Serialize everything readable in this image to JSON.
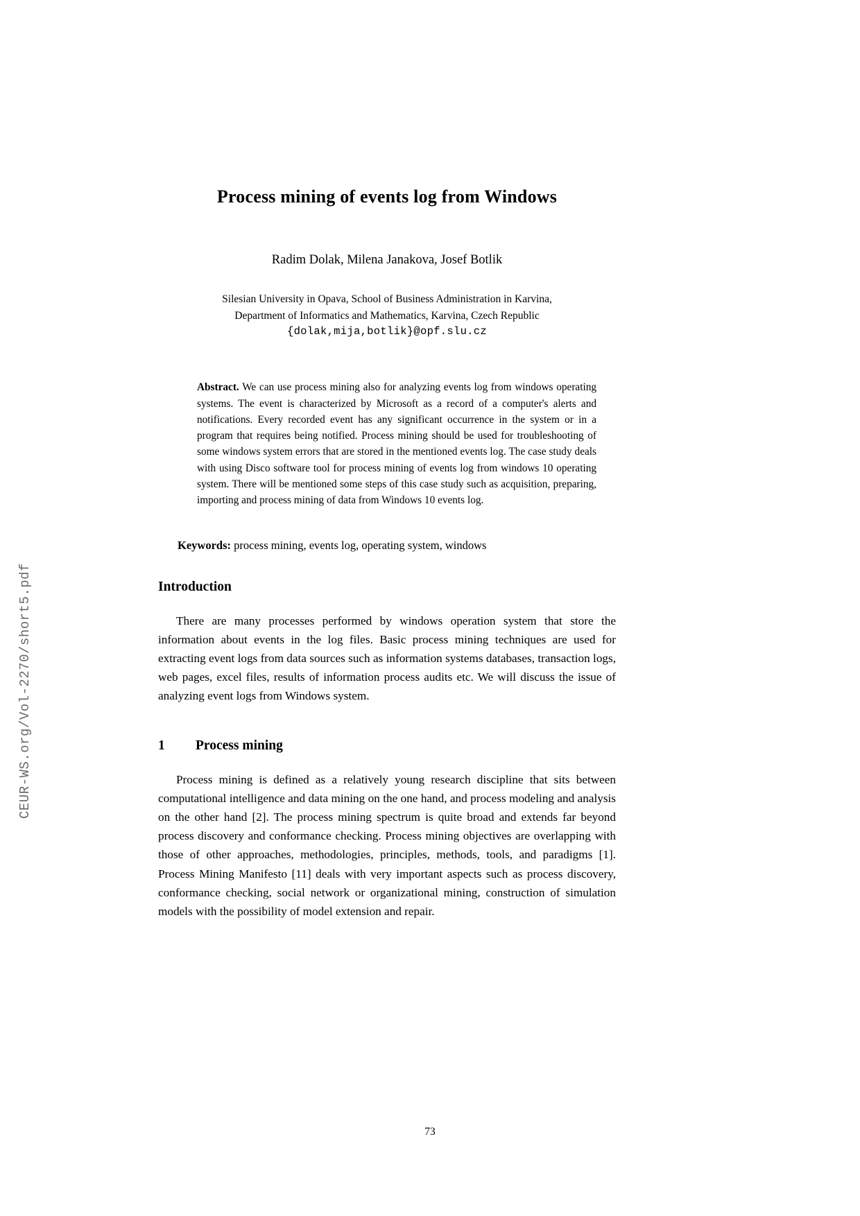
{
  "watermark": {
    "text": "CEUR-WS.org/Vol-2270/short5.pdf"
  },
  "paper": {
    "title": "Process mining of events log from Windows",
    "authors": "Radim Dolak, Milena Janakova, Josef Botlik",
    "affiliation_line1": "Silesian University in Opava, School of Business Administration in Karvina,",
    "affiliation_line2": "Department of Informatics and Mathematics, Karvina, Czech Republic",
    "email": "{dolak,mija,botlik}@opf.slu.cz"
  },
  "abstract": {
    "label": "Abstract.",
    "text": " We can use process mining also for analyzing events log from windows operating systems. The event is characterized by Microsoft as a record of a computer's alerts and notifications. Every recorded event has any significant occurrence in the system or in a program that requires being notified. Process mining should be used for troubleshooting of some windows system errors that are stored in the mentioned events log. The case study deals with using Disco software tool for process mining of events log from windows 10 operating system. There will be mentioned some steps of this case study such as acquisition, preparing, importing and process mining of data from Windows 10 events log."
  },
  "keywords": {
    "label": "Keywords:",
    "text": " process mining, events log, operating system, windows"
  },
  "sections": {
    "introduction": {
      "heading": "Introduction",
      "paragraph": "There are many processes performed by windows operation system that store the information about events in the log files. Basic process mining techniques are used for extracting event logs from data sources such as information systems databases, transaction logs, web pages, excel files, results of information process audits etc. We will discuss the issue of analyzing event logs from Windows system."
    },
    "process_mining": {
      "number": "1",
      "heading": "Process mining",
      "paragraph": "Process mining is defined as a relatively young research discipline that sits between computational intelligence and data mining on the one hand, and process modeling and analysis on the other hand [2]. The process mining spectrum is quite broad and extends far beyond process discovery and conformance checking. Process mining objectives are overlapping with those of other approaches, methodologies, principles, methods, tools, and paradigms [1]. Process Mining Manifesto [11] deals with very important aspects such as process discovery, conformance checking, social network or organizational mining, construction of simulation models with the possibility of model extension and repair."
    }
  },
  "footer": {
    "page_number": "73"
  }
}
